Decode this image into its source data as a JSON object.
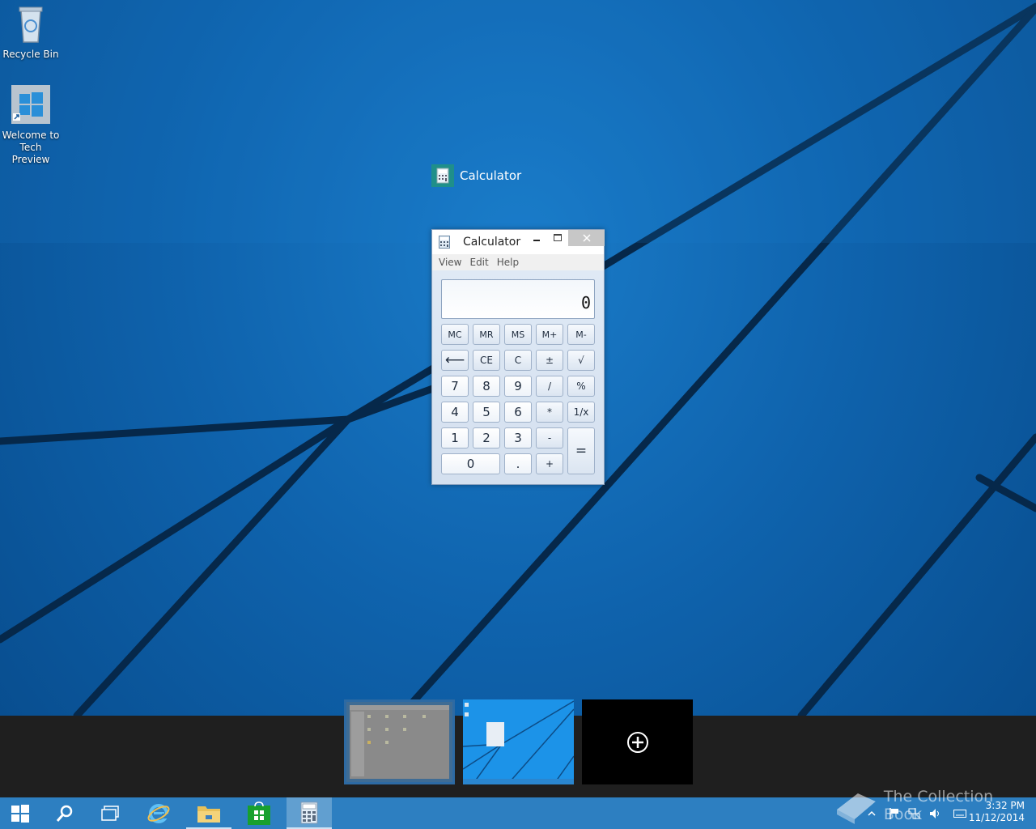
{
  "desktop": {
    "icons": [
      {
        "label": "Recycle Bin",
        "icon": "recycle-bin-icon"
      },
      {
        "label": "Welcome to Tech Preview",
        "icon": "windows-logo-icon"
      }
    ]
  },
  "task_view": {
    "window_label": "Calculator",
    "add_desktop_icon": "plus-circle-icon"
  },
  "calculator": {
    "title": "Calculator",
    "menu": [
      "View",
      "Edit",
      "Help"
    ],
    "display": "0",
    "keys": {
      "mc": "MC",
      "mr": "MR",
      "ms": "MS",
      "mplus": "M+",
      "mminus": "M-",
      "back": "⟵",
      "ce": "CE",
      "c": "C",
      "neg": "±",
      "sqrt": "√",
      "k7": "7",
      "k8": "8",
      "k9": "9",
      "div": "/",
      "pct": "%",
      "k4": "4",
      "k5": "5",
      "k6": "6",
      "mul": "*",
      "recip": "1/x",
      "k1": "1",
      "k2": "2",
      "k3": "3",
      "sub": "-",
      "eq": "=",
      "k0": "0",
      "dot": ".",
      "add": "+"
    }
  },
  "taskbar": {
    "items": [
      "start-icon",
      "search-icon",
      "task-view-icon",
      "internet-explorer-icon",
      "file-explorer-icon",
      "store-icon",
      "calculator-icon"
    ]
  },
  "tray": {
    "time": "3:32 PM",
    "date": "11/12/2014"
  },
  "watermark": "The Collection Book",
  "colors": {
    "taskbar": "#2d7fc1",
    "wallpaper": "#0f63ad",
    "task_view_strip": "#1f1f1f"
  }
}
